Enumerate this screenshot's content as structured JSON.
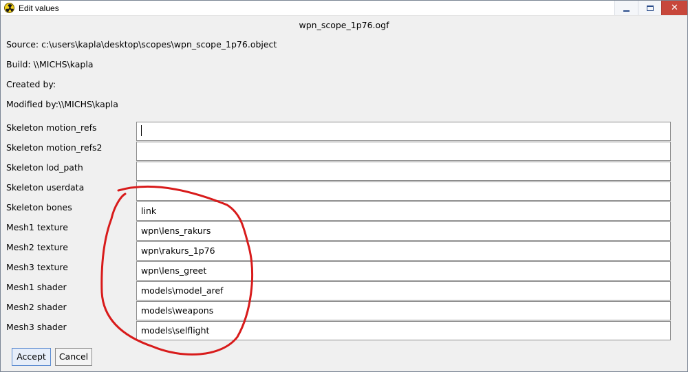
{
  "window": {
    "title": "Edit values",
    "icon": "radiation-icon",
    "controls": {
      "minimize": "minimize-icon",
      "maximize": "maximize-icon",
      "close": "close-icon",
      "close_color": "#c7473b"
    }
  },
  "header": {
    "file_name": "wpn_scope_1p76.ogf"
  },
  "info": {
    "source": "Source: c:\\users\\kapla\\desktop\\scopes\\wpn_scope_1p76.object",
    "build": "Build: \\\\MICHS\\kapla",
    "created_by": "Created by:",
    "modified_by": "Modified by:\\\\MICHS\\kapla"
  },
  "fields": [
    {
      "label": "Skeleton motion_refs",
      "value": "",
      "focused": true
    },
    {
      "label": "Skeleton motion_refs2",
      "value": ""
    },
    {
      "label": "Skeleton lod_path",
      "value": ""
    },
    {
      "label": "Skeleton userdata",
      "value": ""
    },
    {
      "label": "Skeleton bones",
      "value": "link"
    },
    {
      "label": "Mesh1 texture",
      "value": "wpn\\lens_rakurs"
    },
    {
      "label": "Mesh2 texture",
      "value": "wpn\\rakurs_1p76"
    },
    {
      "label": "Mesh3 texture",
      "value": "wpn\\lens_greet"
    },
    {
      "label": "Mesh1 shader",
      "value": "models\\model_aref"
    },
    {
      "label": "Mesh2 shader",
      "value": "models\\weapons"
    },
    {
      "label": "Mesh3 shader",
      "value": "models\\selflight"
    }
  ],
  "buttons": {
    "accept": "Accept",
    "cancel": "Cancel"
  },
  "annotation": {
    "color": "#d81b1b"
  }
}
